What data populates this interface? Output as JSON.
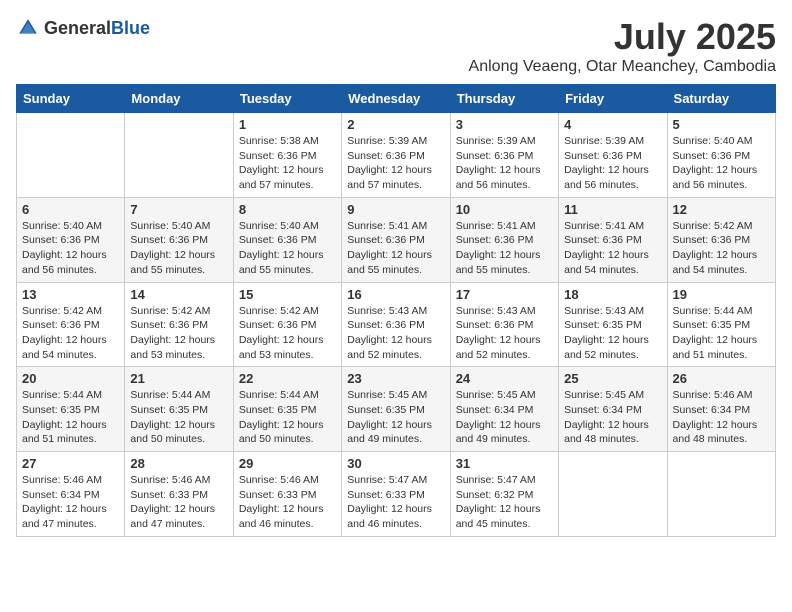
{
  "header": {
    "logo_general": "General",
    "logo_blue": "Blue",
    "month": "July 2025",
    "location": "Anlong Veaeng, Otar Meanchey, Cambodia"
  },
  "weekdays": [
    "Sunday",
    "Monday",
    "Tuesday",
    "Wednesday",
    "Thursday",
    "Friday",
    "Saturday"
  ],
  "weeks": [
    [
      {
        "day": "",
        "sunrise": "",
        "sunset": "",
        "daylight": ""
      },
      {
        "day": "",
        "sunrise": "",
        "sunset": "",
        "daylight": ""
      },
      {
        "day": "1",
        "sunrise": "Sunrise: 5:38 AM",
        "sunset": "Sunset: 6:36 PM",
        "daylight": "Daylight: 12 hours and 57 minutes."
      },
      {
        "day": "2",
        "sunrise": "Sunrise: 5:39 AM",
        "sunset": "Sunset: 6:36 PM",
        "daylight": "Daylight: 12 hours and 57 minutes."
      },
      {
        "day": "3",
        "sunrise": "Sunrise: 5:39 AM",
        "sunset": "Sunset: 6:36 PM",
        "daylight": "Daylight: 12 hours and 56 minutes."
      },
      {
        "day": "4",
        "sunrise": "Sunrise: 5:39 AM",
        "sunset": "Sunset: 6:36 PM",
        "daylight": "Daylight: 12 hours and 56 minutes."
      },
      {
        "day": "5",
        "sunrise": "Sunrise: 5:40 AM",
        "sunset": "Sunset: 6:36 PM",
        "daylight": "Daylight: 12 hours and 56 minutes."
      }
    ],
    [
      {
        "day": "6",
        "sunrise": "Sunrise: 5:40 AM",
        "sunset": "Sunset: 6:36 PM",
        "daylight": "Daylight: 12 hours and 56 minutes."
      },
      {
        "day": "7",
        "sunrise": "Sunrise: 5:40 AM",
        "sunset": "Sunset: 6:36 PM",
        "daylight": "Daylight: 12 hours and 55 minutes."
      },
      {
        "day": "8",
        "sunrise": "Sunrise: 5:40 AM",
        "sunset": "Sunset: 6:36 PM",
        "daylight": "Daylight: 12 hours and 55 minutes."
      },
      {
        "day": "9",
        "sunrise": "Sunrise: 5:41 AM",
        "sunset": "Sunset: 6:36 PM",
        "daylight": "Daylight: 12 hours and 55 minutes."
      },
      {
        "day": "10",
        "sunrise": "Sunrise: 5:41 AM",
        "sunset": "Sunset: 6:36 PM",
        "daylight": "Daylight: 12 hours and 55 minutes."
      },
      {
        "day": "11",
        "sunrise": "Sunrise: 5:41 AM",
        "sunset": "Sunset: 6:36 PM",
        "daylight": "Daylight: 12 hours and 54 minutes."
      },
      {
        "day": "12",
        "sunrise": "Sunrise: 5:42 AM",
        "sunset": "Sunset: 6:36 PM",
        "daylight": "Daylight: 12 hours and 54 minutes."
      }
    ],
    [
      {
        "day": "13",
        "sunrise": "Sunrise: 5:42 AM",
        "sunset": "Sunset: 6:36 PM",
        "daylight": "Daylight: 12 hours and 54 minutes."
      },
      {
        "day": "14",
        "sunrise": "Sunrise: 5:42 AM",
        "sunset": "Sunset: 6:36 PM",
        "daylight": "Daylight: 12 hours and 53 minutes."
      },
      {
        "day": "15",
        "sunrise": "Sunrise: 5:42 AM",
        "sunset": "Sunset: 6:36 PM",
        "daylight": "Daylight: 12 hours and 53 minutes."
      },
      {
        "day": "16",
        "sunrise": "Sunrise: 5:43 AM",
        "sunset": "Sunset: 6:36 PM",
        "daylight": "Daylight: 12 hours and 52 minutes."
      },
      {
        "day": "17",
        "sunrise": "Sunrise: 5:43 AM",
        "sunset": "Sunset: 6:36 PM",
        "daylight": "Daylight: 12 hours and 52 minutes."
      },
      {
        "day": "18",
        "sunrise": "Sunrise: 5:43 AM",
        "sunset": "Sunset: 6:35 PM",
        "daylight": "Daylight: 12 hours and 52 minutes."
      },
      {
        "day": "19",
        "sunrise": "Sunrise: 5:44 AM",
        "sunset": "Sunset: 6:35 PM",
        "daylight": "Daylight: 12 hours and 51 minutes."
      }
    ],
    [
      {
        "day": "20",
        "sunrise": "Sunrise: 5:44 AM",
        "sunset": "Sunset: 6:35 PM",
        "daylight": "Daylight: 12 hours and 51 minutes."
      },
      {
        "day": "21",
        "sunrise": "Sunrise: 5:44 AM",
        "sunset": "Sunset: 6:35 PM",
        "daylight": "Daylight: 12 hours and 50 minutes."
      },
      {
        "day": "22",
        "sunrise": "Sunrise: 5:44 AM",
        "sunset": "Sunset: 6:35 PM",
        "daylight": "Daylight: 12 hours and 50 minutes."
      },
      {
        "day": "23",
        "sunrise": "Sunrise: 5:45 AM",
        "sunset": "Sunset: 6:35 PM",
        "daylight": "Daylight: 12 hours and 49 minutes."
      },
      {
        "day": "24",
        "sunrise": "Sunrise: 5:45 AM",
        "sunset": "Sunset: 6:34 PM",
        "daylight": "Daylight: 12 hours and 49 minutes."
      },
      {
        "day": "25",
        "sunrise": "Sunrise: 5:45 AM",
        "sunset": "Sunset: 6:34 PM",
        "daylight": "Daylight: 12 hours and 48 minutes."
      },
      {
        "day": "26",
        "sunrise": "Sunrise: 5:46 AM",
        "sunset": "Sunset: 6:34 PM",
        "daylight": "Daylight: 12 hours and 48 minutes."
      }
    ],
    [
      {
        "day": "27",
        "sunrise": "Sunrise: 5:46 AM",
        "sunset": "Sunset: 6:34 PM",
        "daylight": "Daylight: 12 hours and 47 minutes."
      },
      {
        "day": "28",
        "sunrise": "Sunrise: 5:46 AM",
        "sunset": "Sunset: 6:33 PM",
        "daylight": "Daylight: 12 hours and 47 minutes."
      },
      {
        "day": "29",
        "sunrise": "Sunrise: 5:46 AM",
        "sunset": "Sunset: 6:33 PM",
        "daylight": "Daylight: 12 hours and 46 minutes."
      },
      {
        "day": "30",
        "sunrise": "Sunrise: 5:47 AM",
        "sunset": "Sunset: 6:33 PM",
        "daylight": "Daylight: 12 hours and 46 minutes."
      },
      {
        "day": "31",
        "sunrise": "Sunrise: 5:47 AM",
        "sunset": "Sunset: 6:32 PM",
        "daylight": "Daylight: 12 hours and 45 minutes."
      },
      {
        "day": "",
        "sunrise": "",
        "sunset": "",
        "daylight": ""
      },
      {
        "day": "",
        "sunrise": "",
        "sunset": "",
        "daylight": ""
      }
    ]
  ]
}
